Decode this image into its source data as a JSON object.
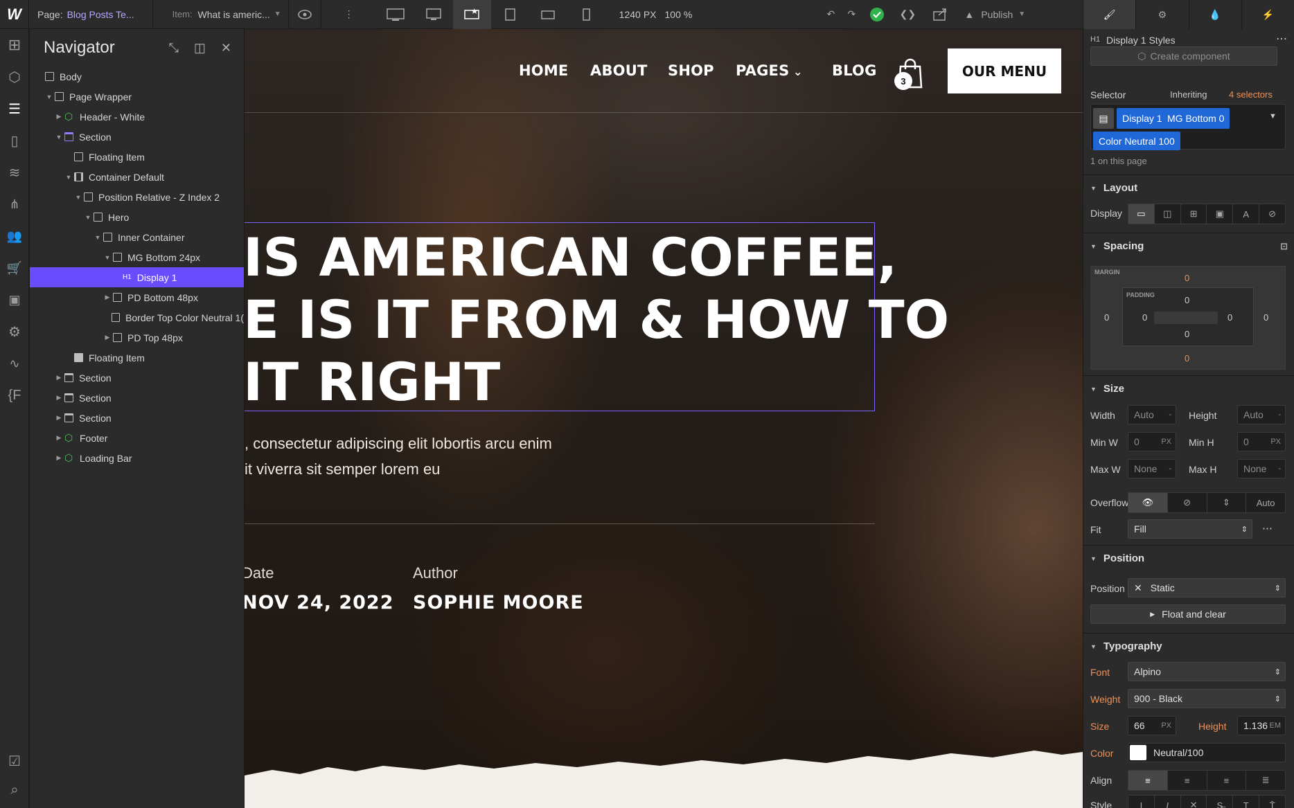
{
  "topbar": {
    "page_label": "Page:",
    "page_name": "Blog Posts Te...",
    "item_label": "Item:",
    "item_name": "What is americ...",
    "width_value": "1240",
    "width_unit": "PX",
    "zoom_value": "100",
    "zoom_unit": "%",
    "publish_label": "Publish"
  },
  "navigator": {
    "title": "Navigator",
    "tree": [
      {
        "label": "Body",
        "depth": 0,
        "icon": "box-icon",
        "expand": "none"
      },
      {
        "label": "Page Wrapper",
        "depth": 1,
        "icon": "box-icon",
        "expand": "open"
      },
      {
        "label": "Header - White",
        "depth": 2,
        "icon": "component-icon",
        "expand": "closed"
      },
      {
        "label": "Section",
        "depth": 2,
        "icon": "section-icon",
        "expand": "open"
      },
      {
        "label": "Floating Item",
        "depth": 3,
        "icon": "box-icon",
        "expand": "none"
      },
      {
        "label": "Container Default",
        "depth": 3,
        "icon": "container-icon",
        "expand": "open"
      },
      {
        "label": "Position Relative - Z Index 2",
        "depth": 4,
        "icon": "box-icon",
        "expand": "open"
      },
      {
        "label": "Hero",
        "depth": 5,
        "icon": "box-icon",
        "expand": "open"
      },
      {
        "label": "Inner Container",
        "depth": 6,
        "icon": "box-icon",
        "expand": "open"
      },
      {
        "label": "MG Bottom 24px",
        "depth": 7,
        "icon": "box-icon",
        "expand": "open"
      },
      {
        "label": "Display 1",
        "depth": 8,
        "icon": "h1-icon",
        "expand": "none",
        "selected": true
      },
      {
        "label": "PD Bottom 48px",
        "depth": 7,
        "icon": "box-icon",
        "expand": "closed"
      },
      {
        "label": "Border Top Color Neutral 1(",
        "depth": 7,
        "icon": "box-icon",
        "expand": "none"
      },
      {
        "label": "PD Top 48px",
        "depth": 7,
        "icon": "box-icon",
        "expand": "closed"
      },
      {
        "label": "Floating Item",
        "depth": 3,
        "icon": "image-icon",
        "expand": "none"
      },
      {
        "label": "Section",
        "depth": 2,
        "icon": "section-icon",
        "expand": "closed"
      },
      {
        "label": "Section",
        "depth": 2,
        "icon": "section-icon",
        "expand": "closed"
      },
      {
        "label": "Section",
        "depth": 2,
        "icon": "section-icon",
        "expand": "closed"
      },
      {
        "label": "Footer",
        "depth": 2,
        "icon": "component-icon",
        "expand": "closed"
      },
      {
        "label": "Loading Bar",
        "depth": 2,
        "icon": "component-icon",
        "expand": "closed"
      }
    ]
  },
  "site": {
    "nav": {
      "home": "HOME",
      "about": "ABOUT",
      "shop": "SHOP",
      "pages": "PAGES",
      "blog": "BLOG",
      "cart_count": "3",
      "menu_button": "OUR MENU"
    },
    "hero_title_lines": [
      "WHAT IS AMERICAN COFFEE,",
      "WHERE IS IT FROM & HOW TO",
      "MAKE IT RIGHT"
    ],
    "hero_title_visible": [
      "IS AMERICAN COFFEE,",
      "E IS IT FROM & HOW TO",
      "IT RIGHT"
    ],
    "paragraph_visible": [
      ", consectetur adipiscing elit lobortis arcu enim",
      "it viverra sit semper lorem eu"
    ],
    "date_label": "Date",
    "date_label_visible": "Date",
    "date_value": "NOV 24, 2022",
    "author_label": "Author",
    "author_value": "SOPHIE MOORE"
  },
  "style_panel": {
    "element_tag": "H1",
    "element_styles": "Display 1 Styles",
    "create_component": "Create component",
    "selector_label": "Selector",
    "inheriting": "Inheriting",
    "inheriting_count": "4 selectors",
    "selector_chips": [
      "Display 1",
      "MG Bottom 0",
      "Color Neutral 100"
    ],
    "on_page": "1 on this page",
    "layout": {
      "title": "Layout",
      "display_label": "Display"
    },
    "spacing": {
      "title": "Spacing",
      "margin_label": "MARGIN",
      "padding_label": "PADDING",
      "margin_top": "0",
      "margin_right": "0",
      "margin_bottom": "0",
      "margin_left": "0",
      "padding_top": "0",
      "padding_right": "0",
      "padding_bottom": "0",
      "padding_left": "0"
    },
    "size": {
      "title": "Size",
      "width_label": "Width",
      "width_value": "Auto",
      "width_unit": "-",
      "height_label": "Height",
      "height_value": "Auto",
      "height_unit": "-",
      "minw_label": "Min W",
      "minw_value": "0",
      "minw_unit": "PX",
      "minh_label": "Min H",
      "minh_value": "0",
      "minh_unit": "PX",
      "maxw_label": "Max W",
      "maxw_value": "None",
      "maxw_unit": "-",
      "maxh_label": "Max H",
      "maxh_value": "None",
      "maxh_unit": "-",
      "overflow_label": "Overflow",
      "overflow_auto": "Auto",
      "fit_label": "Fit",
      "fit_value": "Fill"
    },
    "position": {
      "title": "Position",
      "position_label": "Position",
      "position_value": "Static",
      "float_label": "Float and clear"
    },
    "typography": {
      "title": "Typography",
      "font_label": "Font",
      "font_value": "Alpino",
      "weight_label": "Weight",
      "weight_value": "900 - Black",
      "size_label": "Size",
      "size_value": "66",
      "size_unit": "PX",
      "height_label": "Height",
      "height_value": "1.136",
      "height_unit": "EM",
      "color_label": "Color",
      "color_value": "Neutral/100",
      "align_label": "Align",
      "style_label": "Style"
    }
  },
  "colors": {
    "accent": "#6a4cff",
    "selector_chip": "#2067d8",
    "success": "#2fb34a",
    "label_orange": "#f0925a"
  }
}
